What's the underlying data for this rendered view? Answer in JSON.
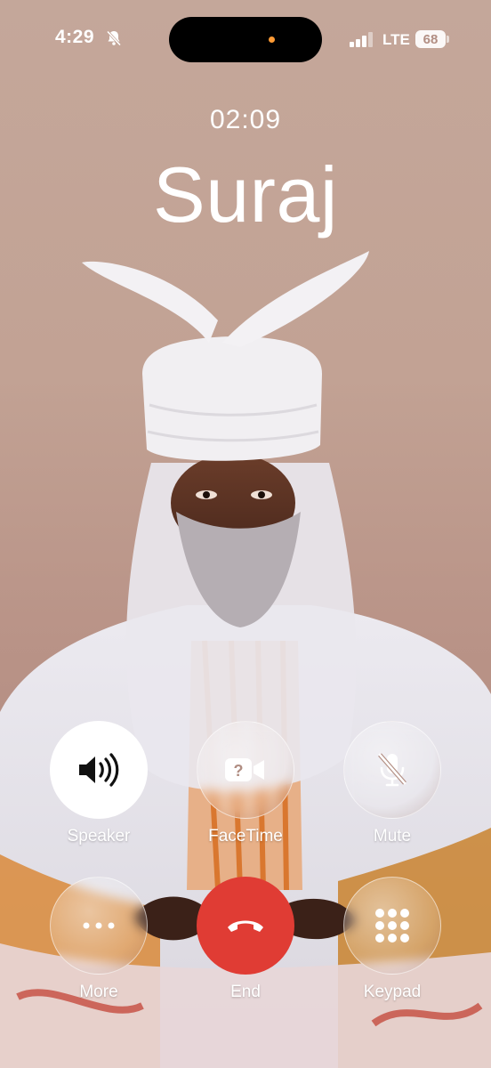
{
  "status_bar": {
    "time": "4:29",
    "carrier": "LTE",
    "battery": "68",
    "icons": [
      "silent-bell-icon",
      "signal-icon"
    ]
  },
  "call": {
    "duration": "02:09",
    "caller_name": "Suraj"
  },
  "controls": [
    {
      "id": "speaker",
      "label": "Speaker",
      "icon": "speaker-icon"
    },
    {
      "id": "facetime",
      "label": "FaceTime",
      "icon": "facetime-icon"
    },
    {
      "id": "mute",
      "label": "Mute",
      "icon": "mic-off-icon"
    },
    {
      "id": "more",
      "label": "More",
      "icon": "more-icon"
    },
    {
      "id": "end",
      "label": "End",
      "icon": "end-call-icon"
    },
    {
      "id": "keypad",
      "label": "Keypad",
      "icon": "keypad-icon"
    }
  ],
  "colors": {
    "background": "#c2a294",
    "end_button": "#e03c34",
    "island_dot": "#ff9b35"
  }
}
